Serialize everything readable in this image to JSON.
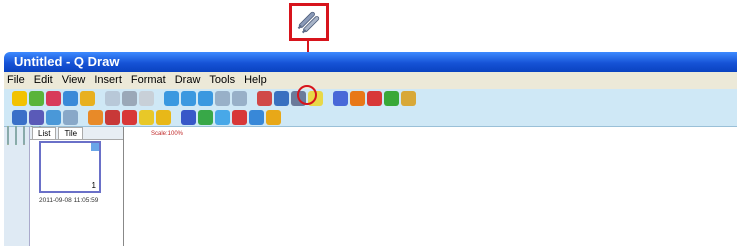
{
  "window": {
    "title": "Untitled - Q Draw"
  },
  "menu": [
    "File",
    "Edit",
    "View",
    "Insert",
    "Format",
    "Draw",
    "Tools",
    "Help"
  ],
  "toolbar_row1": [
    {
      "icon": "new-icon",
      "color": "#f2c200"
    },
    {
      "icon": "open-icon",
      "color": "#5ab43a"
    },
    {
      "icon": "save-icon",
      "color": "#d83a5a"
    },
    {
      "icon": "save-as-icon",
      "color": "#3a8ad8"
    },
    {
      "icon": "print-icon",
      "color": "#e8b020"
    },
    {
      "icon": "copy-icon",
      "color": "#b8c8d8"
    },
    {
      "icon": "cut-icon",
      "color": "#9aa8b8"
    },
    {
      "icon": "paste-icon",
      "color": "#c8d0d8"
    },
    {
      "icon": "zoom-in-icon",
      "color": "#3a98e0"
    },
    {
      "icon": "zoom-out-icon",
      "color": "#3a98e0"
    },
    {
      "icon": "zoom-icon",
      "color": "#3a98e0"
    },
    {
      "icon": "undo-icon",
      "color": "#98b0c8"
    },
    {
      "icon": "redo-icon",
      "color": "#98b0c8"
    },
    {
      "icon": "image-icon",
      "color": "#d04848"
    },
    {
      "icon": "screen-icon",
      "color": "#3870c0"
    },
    {
      "icon": "pen-tool-icon",
      "color": "#6a7a9a"
    },
    {
      "icon": "lock-icon",
      "color": "#e8d848"
    },
    {
      "icon": "book-icon",
      "color": "#4868d8"
    },
    {
      "icon": "palette-icon",
      "color": "#e87818"
    },
    {
      "icon": "ball-icon",
      "color": "#d83838"
    },
    {
      "icon": "puzzle-icon",
      "color": "#38a838"
    },
    {
      "icon": "tools-icon",
      "color": "#d8a838"
    }
  ],
  "toolbar_row2": [
    {
      "icon": "select-icon",
      "color": "#3a70c8"
    },
    {
      "icon": "pencil-icon",
      "color": "#5a5ab8"
    },
    {
      "icon": "brush-icon",
      "color": "#4a98d8"
    },
    {
      "icon": "fill-icon",
      "color": "#88a8c8"
    },
    {
      "icon": "marker-icon",
      "color": "#e88a28"
    },
    {
      "icon": "highlighter-icon",
      "color": "#c83838"
    },
    {
      "icon": "eraser-icon",
      "color": "#d83838"
    },
    {
      "icon": "line-icon",
      "color": "#e8c828"
    },
    {
      "icon": "star-icon",
      "color": "#e8b818"
    },
    {
      "icon": "pointer-icon",
      "color": "#3858c8"
    },
    {
      "icon": "shape-icon",
      "color": "#38a848"
    },
    {
      "icon": "chart-icon",
      "color": "#48a8e8"
    },
    {
      "icon": "table-icon",
      "color": "#d83838"
    },
    {
      "icon": "bar-icon",
      "color": "#3888d8"
    },
    {
      "icon": "stamp-icon",
      "color": "#e8a818"
    }
  ],
  "sidebar_buttons": [
    {
      "icon": "page-icon",
      "color": "#f2c200"
    },
    {
      "icon": "green-page-icon",
      "color": "#58c048"
    },
    {
      "icon": "shapes-icon",
      "color": "#e86a3a"
    },
    {
      "icon": "board-icon",
      "color": "#c8a028"
    },
    {
      "icon": "users-icon",
      "color": "#4898d8"
    }
  ],
  "panel": {
    "tabs": [
      "List",
      "Tile"
    ],
    "page_number": "1",
    "page_date": "2011-09-08 11:05:59"
  },
  "canvas": {
    "scale": "Scale:100%"
  }
}
